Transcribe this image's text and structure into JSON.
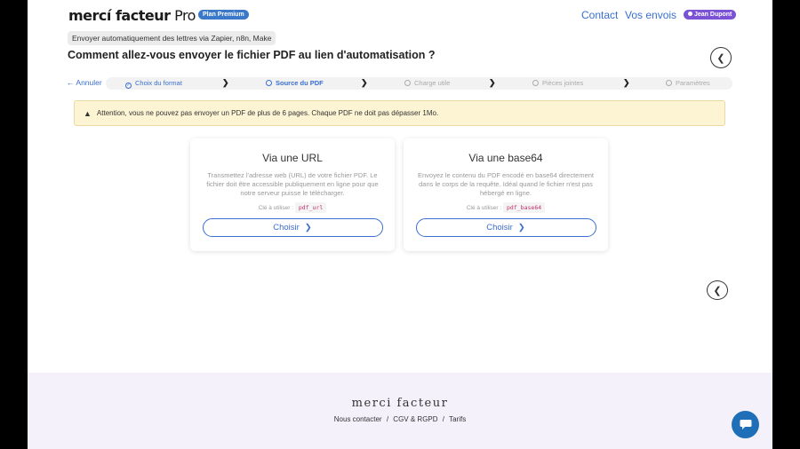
{
  "header": {
    "logo_main": "mercí facteur",
    "logo_suffix": " Pro",
    "plan_badge": "Plan Premium",
    "nav_contact": "Contact",
    "nav_envois": "Vos envois",
    "user": "Jean Dupont"
  },
  "subtitle": "Envoyer automatiquement des lettres via Zapier, n8n, Make",
  "heading": "Comment allez-vous envoyer le fichier PDF au lien d'automatisation ?",
  "steps": {
    "cancel": "Annuler",
    "items": [
      {
        "label": "Choix du format",
        "state": "done"
      },
      {
        "label": "Source du PDF",
        "state": "active"
      },
      {
        "label": "Charge utile",
        "state": "pending"
      },
      {
        "label": "Pièces jointes",
        "state": "pending"
      },
      {
        "label": "Paramètres",
        "state": "pending"
      }
    ]
  },
  "warning": "Attention, vous ne pouvez pas envoyer un PDF de plus de 6 pages. Chaque PDF ne doit pas dépasser 1Mo.",
  "cards": [
    {
      "title": "Via une URL",
      "description": "Transmettez l'adresse web (URL) de votre fichier PDF. Le fichier doit être accessible publiquement en ligne pour que notre serveur puisse le télécharger.",
      "key_label": "Clé à utiliser :",
      "key": "pdf_url",
      "button": "Choisir"
    },
    {
      "title": "Via une base64",
      "description": "Envoyez le contenu du PDF encodé en base64 directement dans le corps de la requête. Idéal quand le fichier n'est pas hébergé en ligne.",
      "key_label": "Clé à utiliser :",
      "key": "pdf_base64",
      "button": "Choisir"
    }
  ],
  "footer": {
    "logo": "merci facteur",
    "links": [
      "Nous contacter",
      "CGV & RGPD",
      "Tarifs"
    ],
    "separator": "/"
  },
  "colors": {
    "accent": "#3a6fd0",
    "premium_badge": "#3a78c9",
    "user_badge": "#7b52d6",
    "warning_bg": "#fdf4d4",
    "footer_bg": "#f4f1fa",
    "chat_button": "#1e6fb8"
  }
}
